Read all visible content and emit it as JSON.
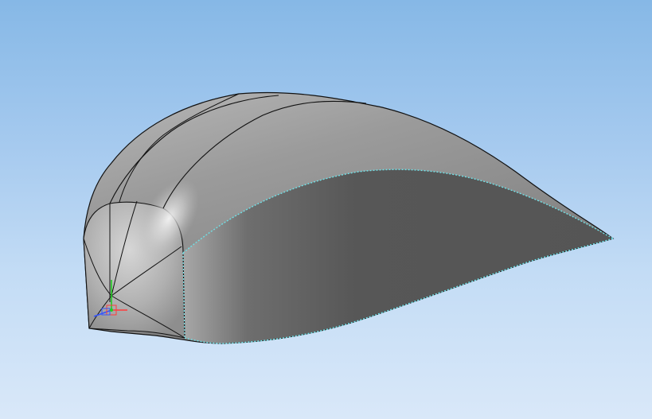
{
  "viewport": {
    "background_top": "#86b8e6",
    "background_bottom": "#d9e8f9"
  },
  "model": {
    "surface_color": "#7a7a7a",
    "highlight_color": "#e6e6e6",
    "edge_color": "#111111",
    "selected_edge_color": "#6fe0e6"
  },
  "triad": {
    "x_color": "#ff3b3b",
    "y_color": "#22cc22",
    "z_color": "#3355ff"
  }
}
